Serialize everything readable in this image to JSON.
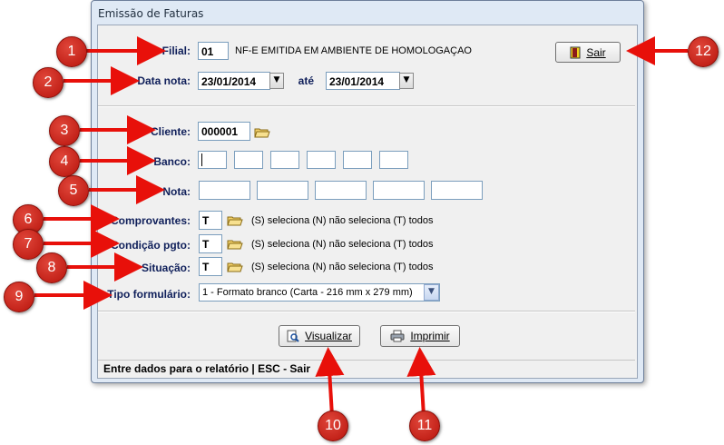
{
  "window": {
    "title": "Emissão de Faturas"
  },
  "filial": {
    "label": "Filial:",
    "value": "01",
    "description": "NF-E EMITIDA EM AMBIENTE DE HOMOLOGAÇAO"
  },
  "data_nota": {
    "label": "Data nota:",
    "from": "23/01/2014",
    "to_label": "até",
    "to": "23/01/2014"
  },
  "cliente": {
    "label": "Cliente:",
    "value": "000001"
  },
  "banco": {
    "label": "Banco:",
    "values": [
      "",
      "",
      "",
      "",
      "",
      ""
    ]
  },
  "nota": {
    "label": "Nota:",
    "values": [
      "",
      "",
      "",
      "",
      ""
    ]
  },
  "comprovantes": {
    "label": "Comprovantes:",
    "value": "T",
    "hint": "(S) seleciona  (N) não seleciona  (T) todos"
  },
  "condicao": {
    "label": "Condição pgto:",
    "value": "T",
    "hint": "(S) seleciona  (N) não seleciona  (T) todos"
  },
  "situacao": {
    "label": "Situação:",
    "value": "T",
    "hint": "(S) seleciona  (N) não seleciona  (T) todos"
  },
  "tipo": {
    "label": "Tipo formulário:",
    "value": "1 - Formato branco  (Carta - 216 mm x 279 mm)"
  },
  "buttons": {
    "sair": "Sair",
    "visualizar": "Visualizar",
    "imprimir": "Imprimir"
  },
  "status": "Entre dados para o relatório  |  ESC - Sair",
  "badges": [
    "1",
    "2",
    "3",
    "4",
    "5",
    "6",
    "7",
    "8",
    "9",
    "10",
    "11",
    "12"
  ],
  "icons": {
    "folder": "folder-open-icon",
    "exit": "door-exit-icon",
    "preview": "magnifier-page-icon",
    "print": "printer-icon",
    "dropdown": "chevron-down-icon"
  },
  "colors": {
    "label": "#0f1f5a",
    "badge": "#c81e14",
    "arrow": "#e8100a"
  }
}
